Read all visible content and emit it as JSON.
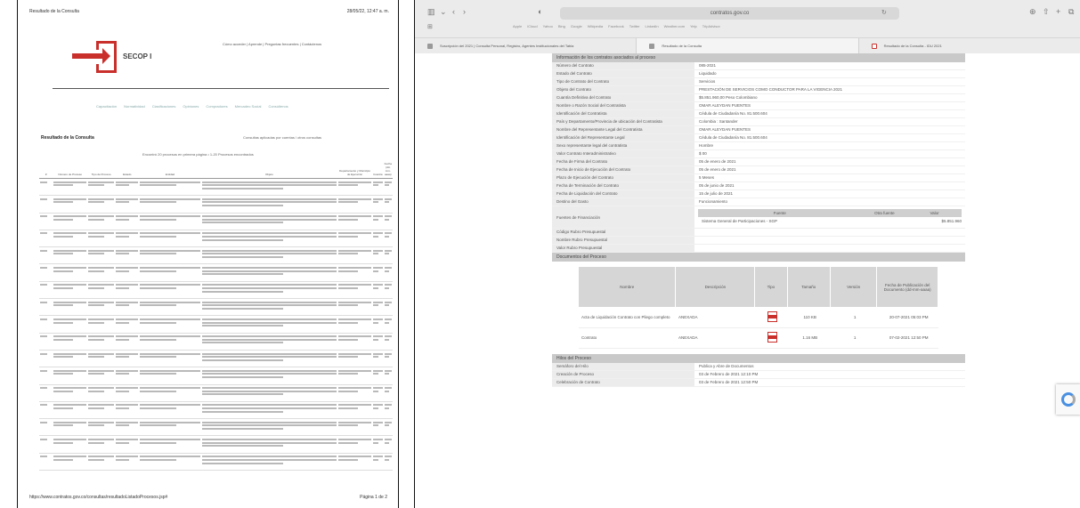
{
  "pdf": {
    "header_left": "Resultado de la Consulta",
    "header_right": "28/05/22, 12:47 a. m.",
    "logo_text": "SECOP I",
    "top_links": "Cómo acceder  |  Aprende  |  Preguntas frecuentes  |  Contáctenos",
    "nav": [
      "Capacitación",
      "Normatividad",
      "Clasificaciones",
      "Opiniones",
      "Compradores",
      "Mercadeo Social",
      "Consúltenos"
    ],
    "title": "Resultado de la Consulta",
    "title_right": "Consultas aplicadas por cuentas / otros consultas",
    "caption": "Encontró 20 procesos en primera página • 1-20 Procesos encontrados",
    "columns": [
      "#",
      "Número de Proceso",
      "Tipo de Proceso",
      "Estado",
      "Entidad",
      "Objeto",
      "Departamento y Municipio de Ejecución",
      "Cuantía",
      "Fecha (dd-mm-aaaa)"
    ],
    "footer_left": "https://www.contratos.gov.co/consultas/resultadoListadoProcesos.jsp#",
    "footer_right": "Página 1 de 2"
  },
  "browser": {
    "url": "contratos.gov.co",
    "favorites": [
      "Apple",
      "iCloud",
      "Yahoo",
      "Bing",
      "Google",
      "Wikipedia",
      "Facebook",
      "Twitter",
      "LinkedIn",
      "Weather.com",
      "Yelp",
      "TripAdvisor"
    ],
    "tabs": [
      {
        "label": "Suscripción del 2021 | Consulta Personal, Registro, Agentes Institucionales del Tabla"
      },
      {
        "label": "Resultado de la Consulta"
      },
      {
        "label": "Resultado de la Consulta - IDU 2021"
      }
    ],
    "section_title": "Información de los contratos asociados al proceso",
    "fields": [
      {
        "k": "Número del Contrato",
        "v": "085-2021"
      },
      {
        "k": "Estado del Contrato",
        "v": "Liquidado"
      },
      {
        "k": "Tipo de Contrato del Contrato",
        "v": "Servicios"
      },
      {
        "k": "Objeto del Contrato",
        "v": "PRESTACIÓN DE SERVICIOS COMO CONDUCTOR PARA LA VIGENCIA 2021"
      },
      {
        "k": "Cuantía Definitiva del Contrato",
        "v": "$5.851.960,00 Peso Colombiano"
      },
      {
        "k": "Nombre o Razón Social del Contratista",
        "v": "OMAR ALEYDAN PUENTES"
      },
      {
        "k": "Identificación del Contratista",
        "v": "Cédula de Ciudadanía No. 81.500.604"
      },
      {
        "k": "País y Departamento/Provincia de ubicación del Contratista",
        "v": "Colombia : Santander"
      },
      {
        "k": "Nombre del Representante Legal del Contratista",
        "v": "OMAR ALEYDAN PUENTES"
      },
      {
        "k": "Identificación del Representante Legal",
        "v": "Cédula de Ciudadanía No. 81.500.604"
      },
      {
        "k": "Sexo representante legal del contratista",
        "v": "Hombre"
      },
      {
        "k": "Valor Contrato Interadministrativo",
        "v": "$ 00"
      },
      {
        "k": "Fecha de Firma del Contrato",
        "v": "05 de enero de 2021"
      },
      {
        "k": "Fecha de Inicio de Ejecución del Contrato",
        "v": "05 de enero de 2021"
      },
      {
        "k": "Plazo de Ejecución del Contrato",
        "v": "5 Meses"
      },
      {
        "k": "Fecha de Terminación del Contrato",
        "v": "05 de junio de 2021"
      },
      {
        "k": "Fecha de Liquidación del Contrato",
        "v": "15 de julio de 2021"
      },
      {
        "k": "Destino del Gasto",
        "v": "Funcionamiento"
      }
    ],
    "fuentes": {
      "label": "Fuentes de Financiación",
      "headers": [
        "Fuente",
        "Otra fuente",
        "Valor"
      ],
      "rows": [
        [
          "Sistema General de Participaciones - SGP",
          "",
          "$5.851.960"
        ]
      ]
    },
    "extra_fields": [
      {
        "k": "Código Rubro Presupuestal",
        "v": ""
      },
      {
        "k": "Nombre Rubro Presupuestal",
        "v": ""
      },
      {
        "k": "Valor Rubro Presupuestal",
        "v": ""
      }
    ],
    "docs_section_title": "Documentos del Proceso",
    "docs_headers": [
      "Nombre",
      "Descripción",
      "Tipo",
      "Tamaño",
      "Versión",
      "Fecha de Publicación del Documento (dd-mm-aaaa)"
    ],
    "docs": [
      {
        "name": "Acta de Liquidación Contrato con Pliego completo",
        "desc": "ANEXADA",
        "size": "110 KB",
        "version": "1",
        "date": "20-07-2021 05:03 PM"
      },
      {
        "name": "Contrato",
        "desc": "ANEXADA",
        "size": "1.16 MB",
        "version": "1",
        "date": "07-02-2021 12:50 PM"
      }
    ],
    "history_title": "Hilos del Proceso",
    "history": [
      {
        "k": "Semáforo del Hilo",
        "v": "Publica y Abre de Documentos"
      },
      {
        "k": "Creación de Proceso",
        "v": "03 de Febrero de 2021 12:10 PM"
      },
      {
        "k": "Celebración de Contrato",
        "v": "03 de Febrero de 2021 12:50 PM"
      }
    ]
  },
  "colors": {
    "brand_red": "#c9302c",
    "header_gray": "#c9c9c9",
    "chrome_gray": "#ebebeb"
  }
}
